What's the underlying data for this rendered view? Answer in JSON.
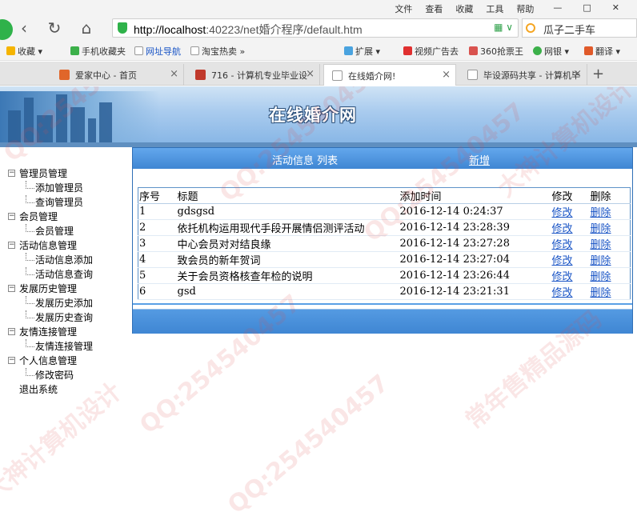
{
  "browser": {
    "menu": [
      "文件",
      "查看",
      "收藏",
      "工具",
      "帮助"
    ],
    "address_url_host": "http://localhost",
    "address_url_rest": ":40223/net婚介程序/default.htm",
    "search_value": "瓜子二手车",
    "bookmarks": [
      "收藏",
      "手机收藏夹",
      "网址导航",
      "淘宝热卖",
      "扩展",
      "视频广告去",
      "360抢票王",
      "网银",
      "翻译"
    ],
    "tabs": [
      {
        "label": "爱家中心 - 首页"
      },
      {
        "label": "716 - 计算机专业毕业设"
      },
      {
        "label": "在线婚介网!"
      },
      {
        "label": "毕设源码共享 - 计算机毕"
      }
    ]
  },
  "page": {
    "banner_title": "在线婚介网",
    "panel_title": "活动信息 列表",
    "add_link": "新增"
  },
  "sidebar": {
    "groups": [
      {
        "label": "管理员管理",
        "items": [
          "添加管理员",
          "查询管理员"
        ]
      },
      {
        "label": "会员管理",
        "items": [
          "会员管理"
        ]
      },
      {
        "label": "活动信息管理",
        "items": [
          "活动信息添加",
          "活动信息查询"
        ]
      },
      {
        "label": "发展历史管理",
        "items": [
          "发展历史添加",
          "发展历史查询"
        ]
      },
      {
        "label": "友情连接管理",
        "items": [
          "友情连接管理"
        ]
      },
      {
        "label": "个人信息管理",
        "items": [
          "修改密码"
        ]
      }
    ],
    "logout": "退出系统"
  },
  "table": {
    "headers": [
      "序号",
      "标题",
      "添加时间",
      "修改",
      "删除"
    ],
    "rows": [
      {
        "no": "1",
        "title": "gdsgsd",
        "time": "2016-12-14 0:24:37",
        "edit": "修改",
        "del": "删除"
      },
      {
        "no": "2",
        "title": "依托机构运用现代手段开展情侣测评活动",
        "time": "2016-12-14 23:28:39",
        "edit": "修改",
        "del": "删除"
      },
      {
        "no": "3",
        "title": "中心会员对对结良缘",
        "time": "2016-12-14 23:27:28",
        "edit": "修改",
        "del": "删除"
      },
      {
        "no": "4",
        "title": "致会员的新年贺词",
        "time": "2016-12-14 23:27:04",
        "edit": "修改",
        "del": "删除"
      },
      {
        "no": "5",
        "title": "关于会员资格核查年检的说明",
        "time": "2016-12-14 23:26:44",
        "edit": "修改",
        "del": "删除"
      },
      {
        "no": "6",
        "title": "gsd",
        "time": "2016-12-14 23:21:31",
        "edit": "修改",
        "del": "删除"
      }
    ]
  },
  "watermarks": [
    "QQ:254540457",
    "常年售精品源码",
    "大神计算机设计"
  ]
}
